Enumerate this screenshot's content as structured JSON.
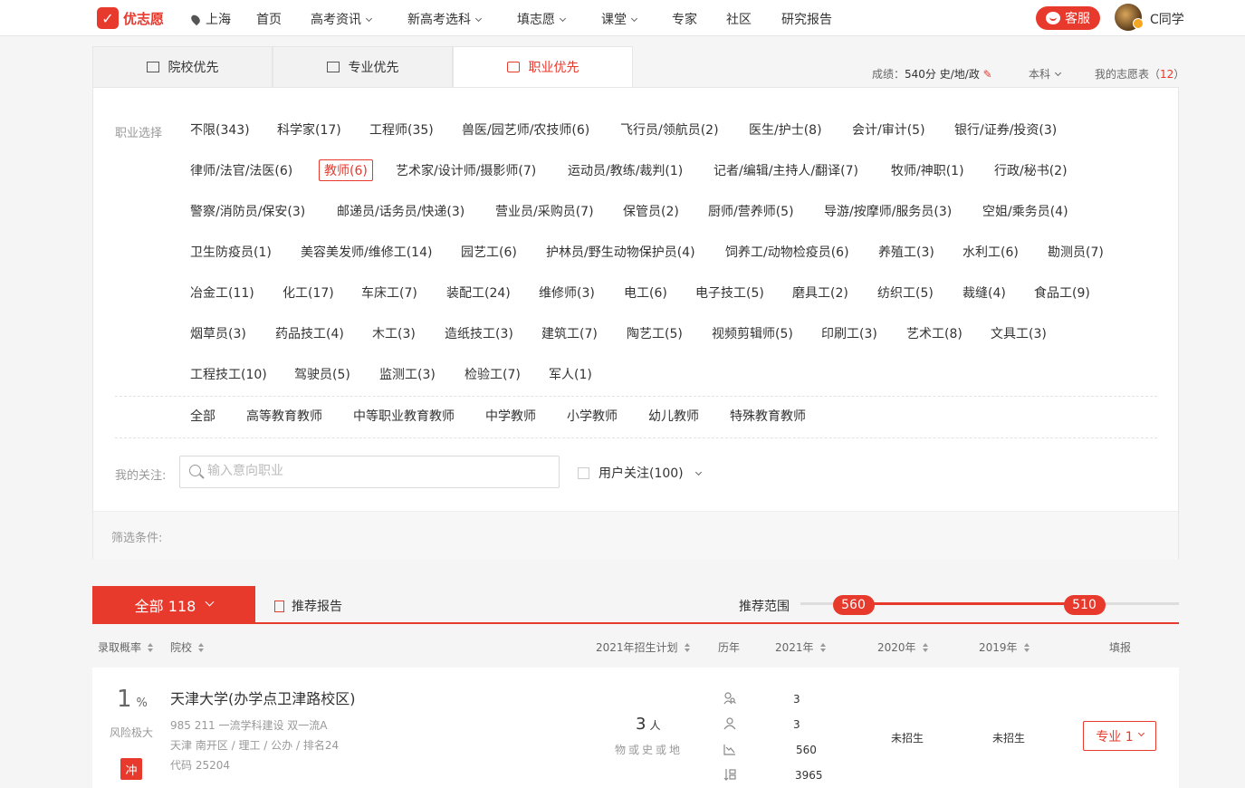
{
  "brand": {
    "name": "优志愿",
    "accent": "#e8392d"
  },
  "nav": {
    "location": "上海",
    "items": [
      "首页",
      "高考资讯",
      "新高考选科",
      "填志愿",
      "课堂",
      "专家",
      "社区",
      "研究报告"
    ],
    "kefu": "客服",
    "username": "C同学"
  },
  "tabs": [
    {
      "label": "院校优先",
      "icon": "building-icon"
    },
    {
      "label": "专业优先",
      "icon": "book-icon"
    },
    {
      "label": "职业优先",
      "icon": "briefcase-icon",
      "active": true
    }
  ],
  "summary": {
    "score_label": "成绩：",
    "score_value": "540分 史/地/政",
    "level": "本科",
    "my_vol_label": "我的志愿表（",
    "my_vol_count": "12",
    "my_vol_close": "）"
  },
  "career": {
    "label": "职业选择",
    "rows": [
      [
        "不限(343)",
        "科学家(17)",
        "工程师(35)",
        "兽医/园艺师/农技师(6)",
        "飞行员/领航员(2)",
        "医生/护士(8)",
        "会计/审计(5)",
        "银行/证券/投资(3)"
      ],
      [
        "律师/法官/法医(6)",
        "教师(6)",
        "艺术家/设计师/摄影师(7)",
        "运动员/教练/裁判(1)",
        "记者/编辑/主持人/翻译(7)",
        "牧师/神职(1)",
        "行政/秘书(2)"
      ],
      [
        "警察/消防员/保安(3)",
        "邮递员/话务员/快递(3)",
        "营业员/采购员(7)",
        "保管员(2)",
        "厨师/营养师(5)",
        "导游/按摩师/服务员(3)",
        "空姐/乘务员(4)"
      ],
      [
        "卫生防疫员(1)",
        "美容美发师/维修工(14)",
        "园艺工(6)",
        "护林员/野生动物保护员(4)",
        "饲养工/动物检疫员(6)",
        "养殖工(3)",
        "水利工(6)",
        "勘测员(7)"
      ],
      [
        "冶金工(11)",
        "化工(17)",
        "车床工(7)",
        "装配工(24)",
        "维修师(3)",
        "电工(6)",
        "电子技工(5)",
        "磨具工(2)",
        "纺织工(5)",
        "裁缝(4)",
        "食品工(9)"
      ],
      [
        "烟草员(3)",
        "药品技工(4)",
        "木工(3)",
        "造纸技工(3)",
        "建筑工(7)",
        "陶艺工(5)",
        "视频剪辑师(5)",
        "印刷工(3)",
        "艺术工(8)",
        "文具工(3)"
      ],
      [
        "工程技工(10)",
        "驾驶员(5)",
        "监测工(3)",
        "检验工(7)",
        "军人(1)"
      ]
    ],
    "selected": "教师(6)",
    "sub_options": [
      "全部",
      "高等教育教师",
      "中等职业教育教师",
      "中学教师",
      "小学教师",
      "幼儿教师",
      "特殊教育教师"
    ]
  },
  "focus": {
    "label": "我的关注:",
    "placeholder": "输入意向职业",
    "user_focus": "用户关注(100)"
  },
  "conditions": {
    "label": "筛选条件:"
  },
  "results": {
    "all_tab": "全部 118",
    "report_link": "推荐报告",
    "range_label": "推荐范围",
    "range_high": "560",
    "range_low": "510",
    "range_fraction": [
      0.14,
      0.75
    ],
    "columns": [
      "录取概率",
      "院校",
      "2021年招生计划",
      "历年",
      "2021年",
      "2020年",
      "2019年",
      "填报"
    ],
    "rows": [
      {
        "probability": "1",
        "probability_unit": "%",
        "risk": "风险极大",
        "tag": "冲",
        "name": "天津大学(办学点卫津路校区)",
        "meta1": "985 211 一流学科建设 双一流A",
        "meta2": "天津 南开区 / 理工 / 公办 / 排名24",
        "meta3": "代码 25204",
        "plan": "3",
        "plan_unit": "人",
        "subjects": "物或史或地",
        "hist_icons": [
          "people-search-icon",
          "person-icon",
          "chart-down-icon",
          "rank-sort-icon"
        ],
        "y2021": [
          "3",
          "3",
          "560",
          "3965"
        ],
        "y2020": "未招生",
        "y2019": "未招生",
        "fill": "专业 1"
      }
    ]
  }
}
